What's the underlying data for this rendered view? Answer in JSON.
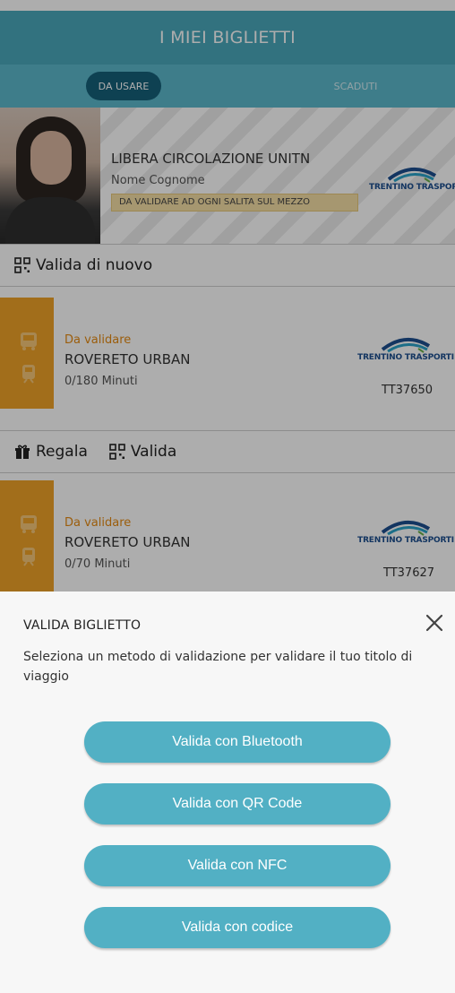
{
  "header": {
    "title": "I MIEI BIGLIETTI"
  },
  "tabs": [
    {
      "label": "DA USARE",
      "active": true
    },
    {
      "label": "SCADUTI",
      "active": false
    }
  ],
  "pass": {
    "title": "LIBERA CIRCOLAZIONE UNITN",
    "name": "Nome Cognome",
    "badge": "DA VALIDARE AD OGNI SALITA SUL MEZZO",
    "brand": "TRENTINO TRASPORTI",
    "action_label": "Valida di nuovo"
  },
  "tickets": [
    {
      "status": "Da validare",
      "route": "ROVERETO URBAN",
      "minutes": "0/180 Minuti",
      "brand": "TRENTINO TRASPORTI",
      "code": "TT37650",
      "gift_label": "Regala",
      "validate_label": "Valida"
    },
    {
      "status": "Da validare",
      "route": "ROVERETO URBAN",
      "minutes": "0/70 Minuti",
      "brand": "TRENTINO TRASPORTI",
      "code": "TT37627"
    }
  ],
  "sheet": {
    "title": "VALIDA BIGLIETTO",
    "description": "Seleziona un metodo di validazione per validare il tuo titolo di viaggio",
    "buttons": [
      {
        "label": "Valida con Bluetooth"
      },
      {
        "label": "Valida con QR Code"
      },
      {
        "label": "Valida con NFC"
      },
      {
        "label": "Valida con codice"
      }
    ]
  },
  "colors": {
    "header": "#4aa8bb",
    "tab_bar": "#5cb9cc",
    "tab_active": "#15607a",
    "ticket_stripe": "#efa329",
    "status": "#e58a12",
    "button": "#52b0c4",
    "sheet_bg": "#f7f7f7"
  },
  "icons": [
    "qr-code-icon",
    "gift-icon",
    "bus-icon",
    "tram-icon",
    "close-icon",
    "trentino-trasporti-logo"
  ]
}
